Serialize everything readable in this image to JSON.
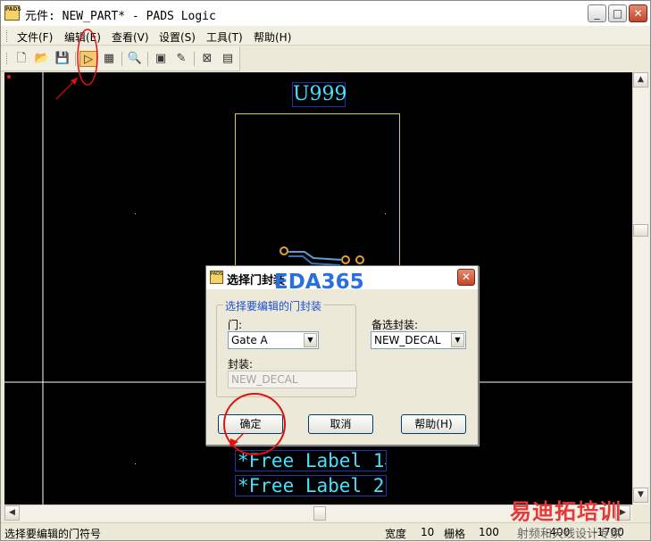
{
  "window": {
    "title": "元件: NEW_PART* - PADS Logic",
    "app_icon_text": "PADS",
    "minimize_glyph": "_",
    "maximize_glyph": "□",
    "close_glyph": "✕"
  },
  "menu": {
    "items": [
      {
        "label": "文件(F)"
      },
      {
        "label": "编辑(E)"
      },
      {
        "label": "查看(V)"
      },
      {
        "label": "设置(S)"
      },
      {
        "label": "工具(T)"
      },
      {
        "label": "帮助(H)"
      }
    ]
  },
  "toolbar": {
    "buttons": [
      {
        "icon": "new-file-icon",
        "glyph": "🗋"
      },
      {
        "icon": "open-folder-icon",
        "glyph": "📂"
      },
      {
        "icon": "save-icon",
        "glyph": "💾"
      },
      {
        "icon": "edit-gate-decal-icon",
        "glyph": "▷",
        "active": true
      },
      {
        "icon": "chip-icon",
        "glyph": "▦"
      },
      {
        "icon": "zoom-icon",
        "glyph": "🔍"
      },
      {
        "icon": "properties-icon",
        "glyph": "▣"
      },
      {
        "icon": "wand-icon",
        "glyph": "✎"
      },
      {
        "icon": "terminal-icon",
        "glyph": "⊠"
      },
      {
        "icon": "windows-icon",
        "glyph": "▤"
      }
    ]
  },
  "canvas": {
    "part_ref": "U999",
    "free_labels": [
      "*Free Label 1",
      "*Free Label 2"
    ],
    "colors": {
      "background": "#000000",
      "text": "#44e0ff",
      "outline": "#e0d020",
      "label_box": "#2233aa"
    }
  },
  "dialog": {
    "title": "选择门封装",
    "icon_text": "PADS",
    "close_glyph": "✕",
    "group_label": "选择要编辑的门封装",
    "gate_label": "门:",
    "gate_value": "Gate A",
    "decal_label": "封装:",
    "decal_value": "NEW_DECAL",
    "alt_decal_label": "备选封装:",
    "alt_decal_value": "NEW_DECAL",
    "ok_label": "确定",
    "cancel_label": "取消",
    "help_label": "帮助(H)"
  },
  "status": {
    "message": "选择要编辑的门符号",
    "width_label": "宽度",
    "width_value": "10",
    "grid_label": "栅格",
    "grid_value": "100",
    "x_value": "-400",
    "y_value": "-1700"
  },
  "watermarks": {
    "eda": "EDA365",
    "cn": "易迪拓培训",
    "cn_sub": "射频和天线设计专家"
  },
  "scroll": {
    "up": "▲",
    "down": "▼",
    "left": "◀",
    "right": "▶"
  },
  "annotations": {
    "highlight_color": "#e01010"
  }
}
